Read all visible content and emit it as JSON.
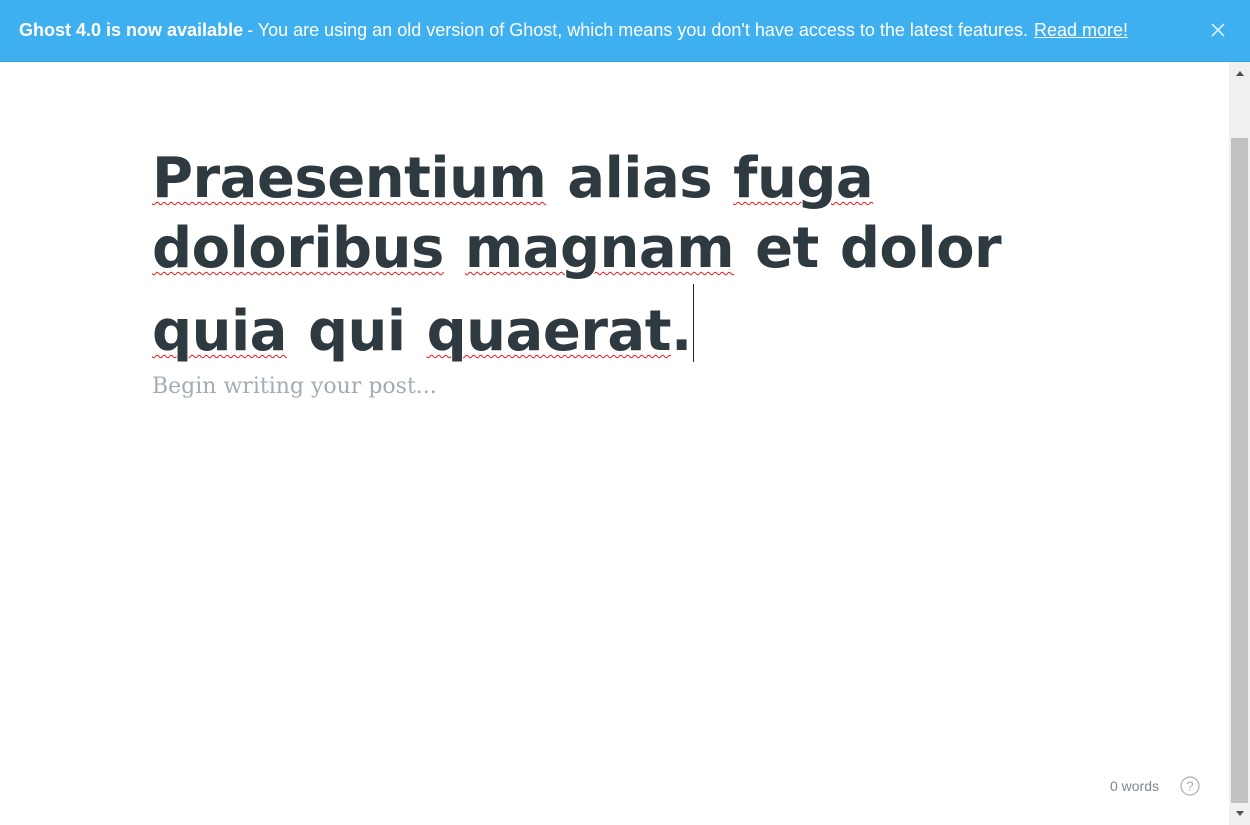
{
  "banner": {
    "headline": "Ghost 4.0 is now available",
    "message": "- You are using an old version of Ghost, which means you don't have access to the latest features.",
    "link_label": "Read more!",
    "close_icon": "close-icon",
    "color": "#3eb0ef"
  },
  "editor": {
    "title_words": [
      "Praesentium",
      "alias",
      "fuga",
      "doloribus",
      "magnam",
      "et",
      "dolor",
      "quia",
      "qui",
      "quaerat",
      "."
    ],
    "body_placeholder": "Begin writing your post...",
    "word_count": "0 words",
    "help_icon": "help-circle-icon"
  },
  "scrollbar": {
    "up_icon": "arrow-up-icon",
    "down_icon": "arrow-down-icon"
  }
}
